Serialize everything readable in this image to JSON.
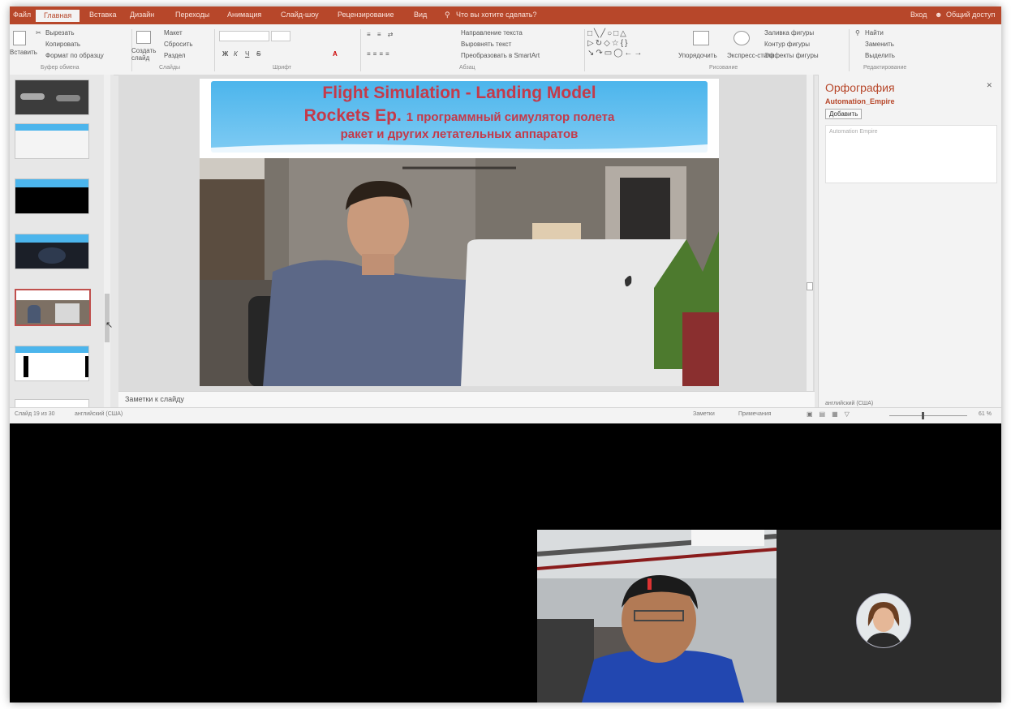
{
  "titlebar": {
    "tabs": [
      "Файл",
      "Главная",
      "Вставка",
      "Дизайн",
      "Переходы",
      "Анимация",
      "Слайд-шоу",
      "Рецензирование",
      "Вид"
    ],
    "active_tab": "Главная",
    "search": "Что вы хотите сделать?",
    "sign_in": "Вход",
    "share": "Общий доступ"
  },
  "ribbon": {
    "clipboard": {
      "cut": "Вырезать",
      "copy": "Копировать",
      "format_painter": "Формат по образцу",
      "paste": "Вставить",
      "label": "Буфер обмена"
    },
    "slides": {
      "new_slide": "Создать слайд",
      "layout": "Макет",
      "reset": "Сбросить",
      "section": "Раздел",
      "label": "Слайды"
    },
    "font": {
      "label": "Шрифт",
      "bold": "Ж",
      "italic": "К",
      "underline": "Ч",
      "strike": "S"
    },
    "paragraph": {
      "text_direction": "Направление текста",
      "align_text": "Выровнять текст",
      "smartart": "Преобразовать в SmartArt",
      "label": "Абзац"
    },
    "drawing": {
      "arrange": "Упорядочить",
      "quick_styles": "Экспресс-стили",
      "fill": "Заливка фигуры",
      "outline": "Контур фигуры",
      "effects": "Эффекты фигуры",
      "label": "Рисование"
    },
    "editing": {
      "find": "Найти",
      "replace": "Заменить",
      "select": "Выделить",
      "label": "Редактирование"
    }
  },
  "slide": {
    "title_line1": "Flight Simulation - Landing Model",
    "title_line2_latin": "Rockets Ep.",
    "title_line2_rest": "1 программный симулятор полета",
    "title_line3": "ракет и других летательных аппаратов"
  },
  "notes": {
    "placeholder": "Заметки к слайду"
  },
  "task_pane": {
    "title": "Орфография",
    "word": "Automation_Empire",
    "button": "Добавить",
    "suggestion": "Automation Empire",
    "language": "английский (США)"
  },
  "status": {
    "slide_count": "Слайд 19 из 30",
    "language": "английский (США)",
    "notes": "Заметки",
    "comments": "Примечания",
    "zoom": "61 %"
  },
  "colors": {
    "accent": "#b7472a",
    "slide_title": "#c43a4a",
    "banner": "#4cb5ec"
  }
}
